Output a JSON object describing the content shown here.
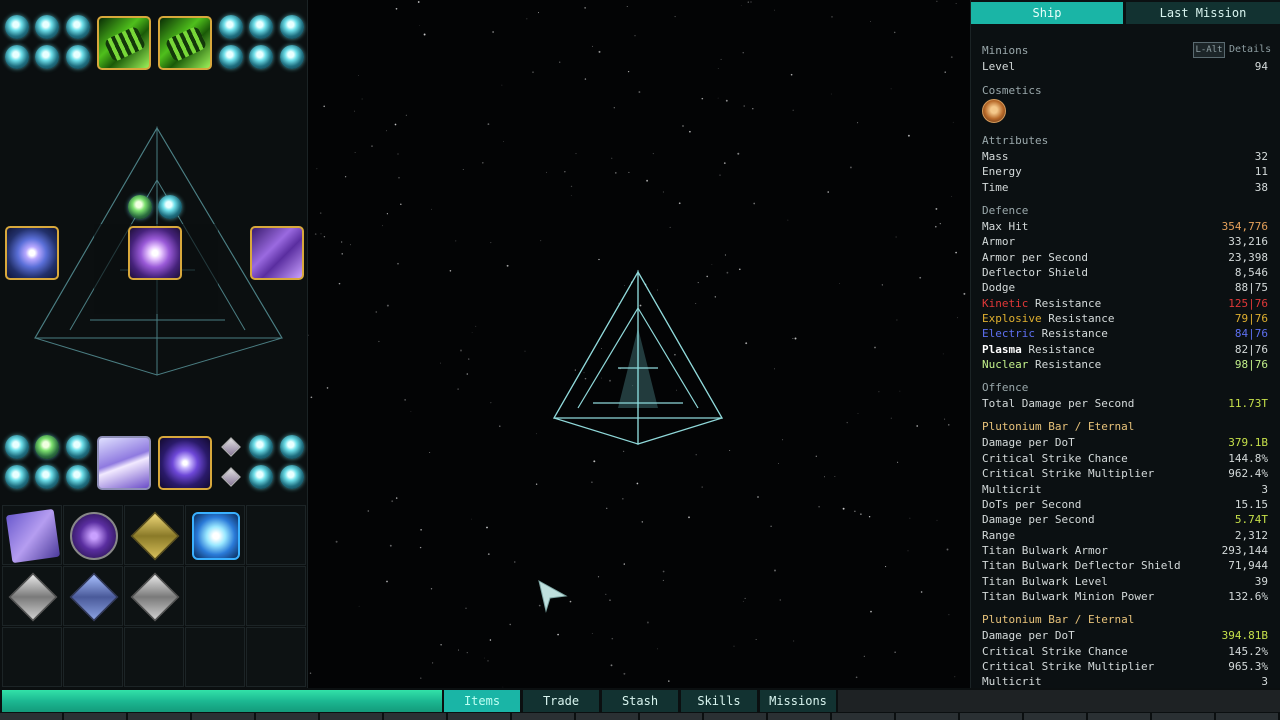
{
  "right_panel": {
    "tabs": [
      "Ship",
      "Last Mission"
    ],
    "minions_label": "Minions",
    "lalt_key": "L-Alt",
    "details_label": "Details",
    "level": {
      "label": "Level",
      "value": "94"
    },
    "cosmetics_label": "Cosmetics",
    "attributes_label": "Attributes",
    "attributes": [
      {
        "label": "Mass",
        "value": "32"
      },
      {
        "label": "Energy",
        "value": "11"
      },
      {
        "label": "Time",
        "value": "38"
      }
    ],
    "defence_label": "Defence",
    "defence": [
      {
        "label": "Max Hit",
        "value": "354,776"
      },
      {
        "label": "Armor",
        "value": "33,216"
      },
      {
        "label": "Armor per Second",
        "value": "23,398"
      },
      {
        "label": "Deflector Shield",
        "value": "8,546"
      },
      {
        "label": "Dodge",
        "value": "88|75"
      }
    ],
    "resistances": [
      {
        "type": "Kinetic",
        "suffix": "Resistance",
        "value": "125|76"
      },
      {
        "type": "Explosive",
        "suffix": "Resistance",
        "value": "79|76"
      },
      {
        "type": "Electric",
        "suffix": "Resistance",
        "value": "84|76"
      },
      {
        "type": "Plasma",
        "suffix": "Resistance",
        "value": "82|76"
      },
      {
        "type": "Nuclear",
        "suffix": "Resistance",
        "value": "98|76"
      }
    ],
    "offence_label": "Offence",
    "total_dps": {
      "label": "Total Damage per Second",
      "value": "11.73T"
    },
    "weapon1": {
      "name": "Plutonium Bar / Eternal",
      "stats": [
        {
          "label": "Damage per DoT",
          "value": "379.1B"
        },
        {
          "label": "Critical Strike Chance",
          "value": "144.8%"
        },
        {
          "label": "Critical Strike Multiplier",
          "value": "962.4%"
        },
        {
          "label": "Multicrit",
          "value": "3"
        },
        {
          "label": "DoTs per Second",
          "value": "15.15"
        },
        {
          "label": "Damage per Second",
          "value": "5.74T"
        },
        {
          "label": "Range",
          "value": "2,312"
        },
        {
          "label": "Titan Bulwark Armor",
          "value": "293,144"
        },
        {
          "label": "Titan Bulwark Deflector Shield",
          "value": "71,944"
        },
        {
          "label": "Titan Bulwark Level",
          "value": "39"
        },
        {
          "label": "Titan Bulwark Minion Power",
          "value": "132.6%"
        }
      ]
    },
    "weapon2": {
      "name": "Plutonium Bar / Eternal",
      "stats": [
        {
          "label": "Damage per DoT",
          "value": "394.81B"
        },
        {
          "label": "Critical Strike Chance",
          "value": "145.2%"
        },
        {
          "label": "Critical Strike Multiplier",
          "value": "965.3%"
        },
        {
          "label": "Multicrit",
          "value": "3"
        }
      ]
    }
  },
  "bottom_bar": {
    "tabs": [
      "Items",
      "Trade",
      "Stash",
      "Skills",
      "Missions"
    ],
    "active_tab": "Items"
  },
  "colors": {
    "accent_teal": "#1ab5a6",
    "tab_dark": "#123231",
    "kinetic": "#e03838",
    "explosive": "#e0b030",
    "electric": "#5d6ff0",
    "plasma": "#ffffff",
    "nuclear": "#c3f08a",
    "highlight_value": "#c6e04a",
    "max_hit_value": "#e6a15a",
    "section_gold": "#e7c27a"
  },
  "icons": {
    "cursor": "ship-cursor-icon",
    "cosmetic": "cosmetic-badge-icon",
    "weapons": "gatling-gun-icon",
    "modules": "portal-module-icon",
    "chips": "energy-orb-icon"
  }
}
